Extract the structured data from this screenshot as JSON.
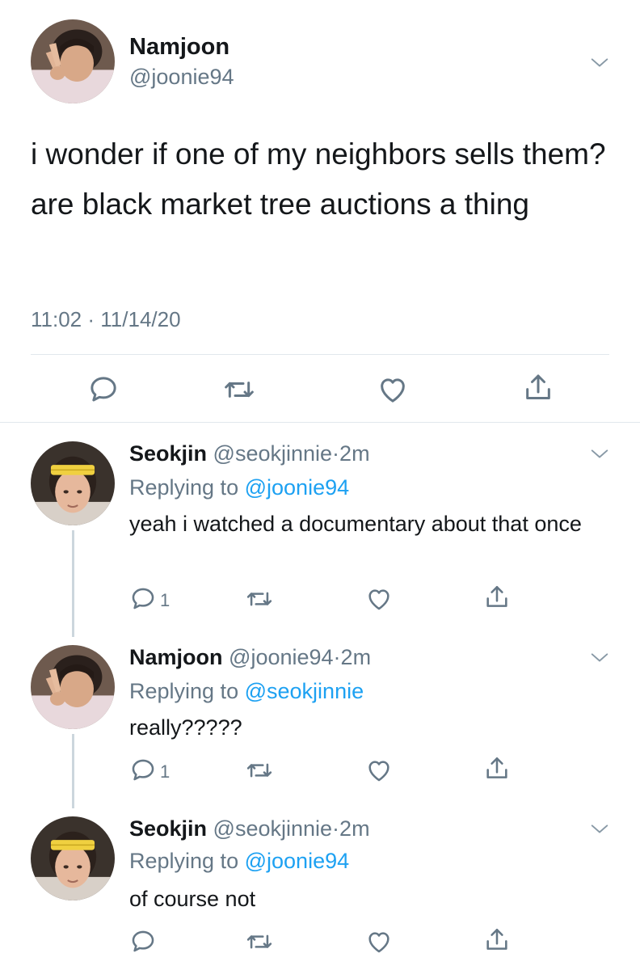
{
  "main_tweet": {
    "name": "Namjoon",
    "handle": "@joonie94",
    "text": "i wonder if one of my neighbors sells them? are black market tree auctions a thing",
    "time": "11:02",
    "separator": "·",
    "date": "11/14/20",
    "avatar_icon": "avatar-peace-sign",
    "menu_icon": "chevron-down-icon"
  },
  "actions_icons": [
    "comment-icon",
    "retweet-icon",
    "like-icon",
    "share-icon"
  ],
  "replies": [
    {
      "name": "Seokjin",
      "handle": "@seokjinnie",
      "separator": "·",
      "age": "2m",
      "replying_prefix": "Replying to",
      "replying_to": "@joonie94",
      "text": "yeah i watched a documentary about that once",
      "reply_count": "1"
    },
    {
      "name": "Namjoon",
      "handle": "@joonie94",
      "separator": "·",
      "age": "2m",
      "replying_prefix": "Replying to",
      "replying_to": "@seokjinnie",
      "text": "really?????",
      "reply_count": "1"
    },
    {
      "name": "Seokjin",
      "handle": "@seokjinnie",
      "separator": "·",
      "age": "2m",
      "replying_prefix": "Replying to",
      "replying_to": "@joonie94",
      "text": "of course not",
      "reply_count": ""
    }
  ],
  "colors": {
    "link": "#1da1f2",
    "secondary_text": "#657786",
    "divider": "#e1e8ed",
    "thread_line": "#ccd6dd"
  }
}
